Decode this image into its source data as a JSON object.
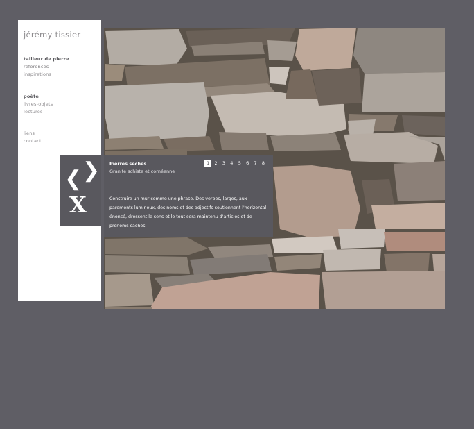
{
  "site": {
    "title": "jérémy tissier"
  },
  "nav": {
    "group1": {
      "heading": "tailleur de pierre",
      "items": [
        "références",
        "inspirations"
      ]
    },
    "group2": {
      "heading": "poète",
      "items": [
        "livres-objets",
        "lectures"
      ]
    },
    "group3": {
      "items": [
        "liens",
        "contact"
      ]
    }
  },
  "viewer": {
    "prev_symbol": "❮",
    "next_symbol": "❯",
    "close_symbol": "X"
  },
  "caption": {
    "title": "Pierres sèches",
    "subtitle": "Granite schiste et cornéenne",
    "body": "Construire un mur comme une phrase. Des verbes, larges, aux parements lumineux, des noms et des adjectifs soutiennent l'horizontal énoncé, dressent le sens et le tout sera maintenu d'articles et de pronoms cachés.",
    "pages": [
      "1",
      "2",
      "3",
      "4",
      "5",
      "6",
      "7",
      "8"
    ],
    "current_page": "1"
  },
  "colors": {
    "background": "#5f5e65",
    "panel": "#59585e",
    "sidebar": "#ffffff"
  }
}
